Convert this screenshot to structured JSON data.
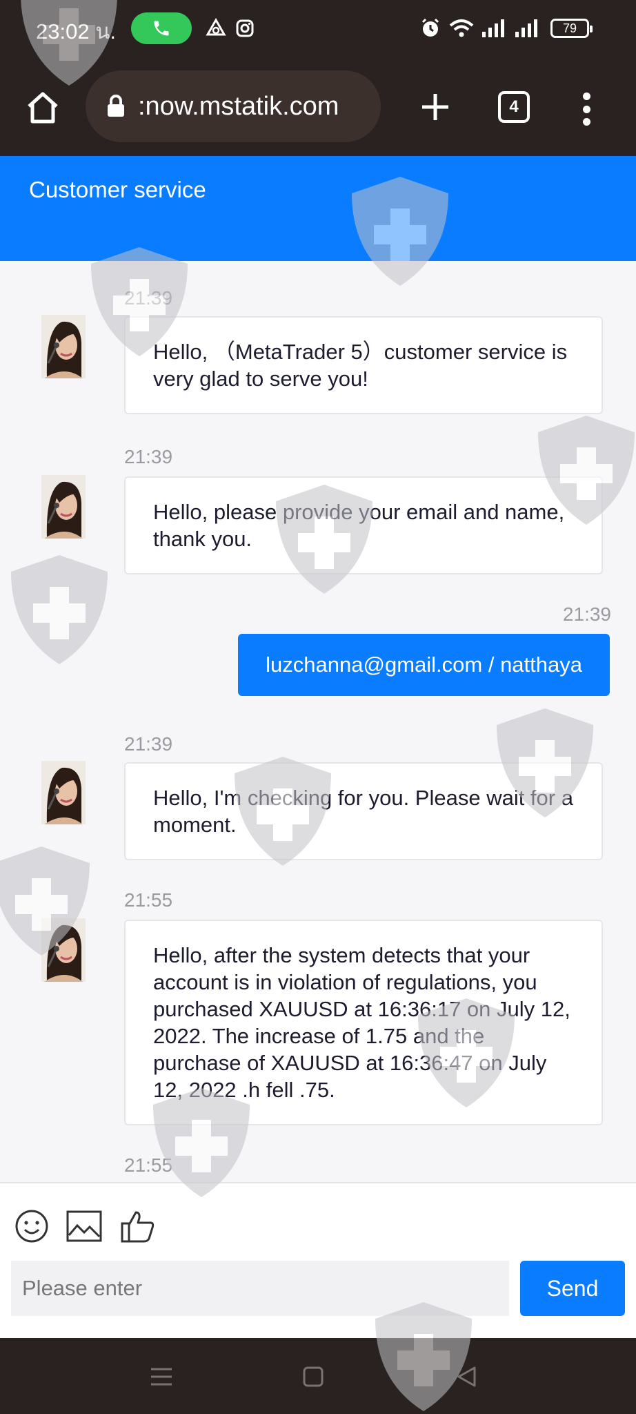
{
  "status_bar": {
    "time": "23:02 น.",
    "battery": "79"
  },
  "browser": {
    "url": ":now.mstatik.com",
    "tab_count": "4"
  },
  "header": {
    "title": "Customer service"
  },
  "messages": [
    {
      "time": "21:39",
      "text": "Hello, （MetaTrader 5）customer service is very glad to serve you!"
    },
    {
      "time": "21:39",
      "text": "Hello, please provide your email and name, thank you."
    },
    {
      "time": "21:39",
      "text": "luzchanna@gmail.com / natthaya"
    },
    {
      "time": "21:39",
      "text": "Hello, I'm checking for you. Please wait for a moment."
    },
    {
      "time": "21:55",
      "text": "Hello, after the system detects that your account is in violation of regulations, you purchased XAUUSD at 16:36:17 on July 12, 2022. The increase of 1.75 and the purchase of XAUUSD at 16:36:47 on July 12, 2022 .h fell .75."
    },
    {
      "time": "21:55",
      "text": ""
    }
  ],
  "composer": {
    "placeholder": "Please enter",
    "send_label": "Send"
  },
  "colors": {
    "accent": "#0a7cff",
    "system_bar": "#2a2220"
  }
}
